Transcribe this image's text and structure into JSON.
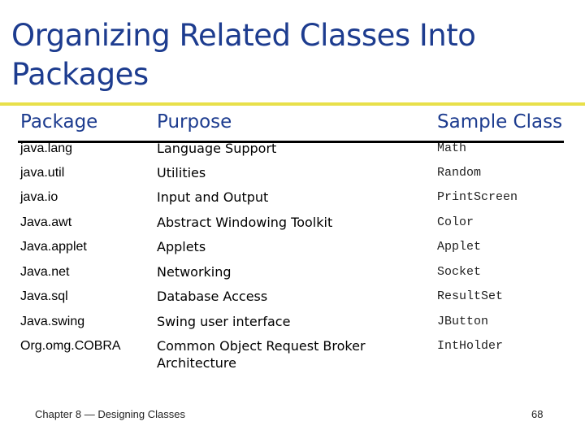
{
  "title": "Organizing Related Classes Into Packages",
  "colors": {
    "title": "#1d3c8f",
    "accent_rule": "#e8e04a"
  },
  "table": {
    "headers": [
      "Package",
      "Purpose",
      "Sample Class"
    ],
    "rows": [
      [
        "java.lang",
        "Language Support",
        "Math"
      ],
      [
        "java.util",
        "Utilities",
        "Random"
      ],
      [
        "java.io",
        "Input and Output",
        "PrintScreen"
      ],
      [
        "Java.awt",
        "Abstract Windowing Toolkit",
        "Color"
      ],
      [
        "Java.applet",
        "Applets",
        "Applet"
      ],
      [
        "Java.net",
        "Networking",
        "Socket"
      ],
      [
        "Java.sql",
        "Database Access",
        "ResultSet"
      ],
      [
        "Java.swing",
        "Swing user interface",
        "JButton"
      ],
      [
        "Org.omg.COBRA",
        "Common Object Request Broker Architecture",
        "IntHolder"
      ]
    ]
  },
  "footer": {
    "chapter": "Chapter 8 — Designing Classes",
    "page": "68"
  }
}
